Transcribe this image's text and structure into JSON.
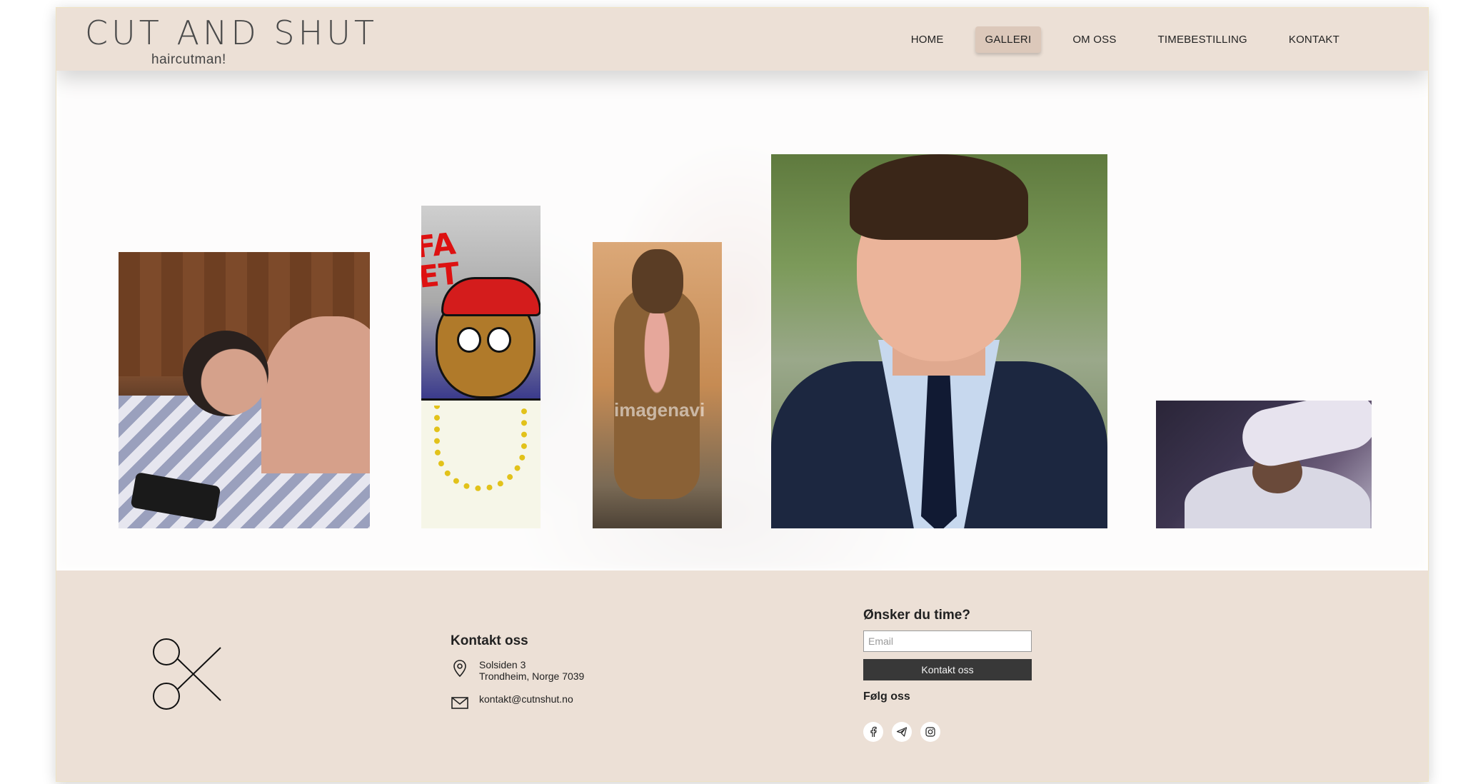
{
  "brand": {
    "logo": "CUT AND SHUT",
    "tagline": "haircutman!"
  },
  "nav": {
    "items": [
      {
        "label": "HOME",
        "active": false
      },
      {
        "label": "GALLERI",
        "active": true
      },
      {
        "label": "OM OSS",
        "active": false
      },
      {
        "label": "TIMEBESTILLING",
        "active": false
      },
      {
        "label": "KONTAKT",
        "active": false
      }
    ]
  },
  "gallery": {
    "photos": [
      {
        "subject": "person-sleeping"
      },
      {
        "subject": "cartoon-character"
      },
      {
        "subject": "monkey-sitting",
        "watermark": "imagenavi"
      },
      {
        "subject": "young-man-in-suit"
      },
      {
        "subject": "monkey-haircut"
      }
    ]
  },
  "footer": {
    "logo_icon": "scissors-icon",
    "contact": {
      "title": "Kontakt oss",
      "address_line1": "Solsiden 3",
      "address_line2": "Trondheim, Norge 7039",
      "email": "kontakt@cutnshut.no"
    },
    "booking": {
      "title": "Ønsker du time?",
      "email_placeholder": "Email",
      "email_value": "",
      "button_label": "Kontakt oss",
      "follow_title": "Følg oss",
      "social": [
        "facebook-icon",
        "telegram-icon",
        "instagram-icon"
      ]
    }
  },
  "colors": {
    "header_bg": "#ece0d6",
    "footer_bg": "#ece0d6",
    "active_tab_bg": "#dcc8ba",
    "button_bg": "#383838"
  }
}
